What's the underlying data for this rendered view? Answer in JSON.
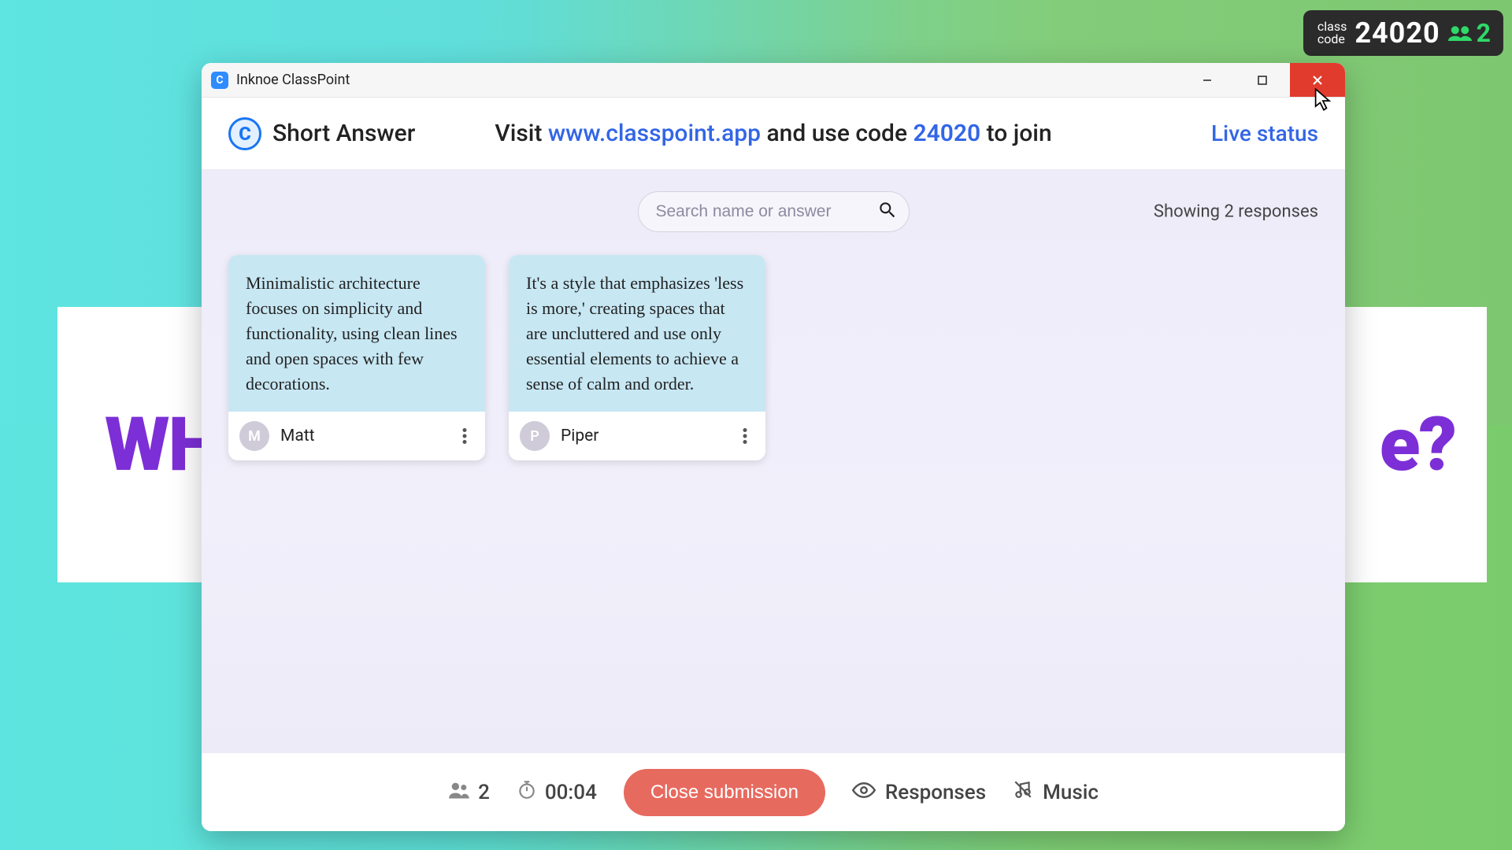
{
  "classBadge": {
    "label_line1": "class",
    "label_line2": "code",
    "code": "24020",
    "participants": "2"
  },
  "slide": {
    "left_fragment": "WH",
    "right_fragment": "e?"
  },
  "window": {
    "title": "Inknoe ClassPoint"
  },
  "header": {
    "activity_title": "Short Answer",
    "visit_prefix": "Visit ",
    "url": "www.classpoint.app",
    "use_code_mid": " and use code ",
    "code": "24020",
    "to_join": " to join",
    "live_status": "Live status"
  },
  "search": {
    "placeholder": "Search name or answer"
  },
  "showing": {
    "prefix": "Showing ",
    "count": "2",
    "suffix": " responses"
  },
  "responses": [
    {
      "text": "Minimalistic architecture focuses on simplicity and functionality, using clean lines and open spaces with few decorations.",
      "initial": "M",
      "name": "Matt"
    },
    {
      "text": "It's a style that emphasizes 'less is more,' creating spaces that are uncluttered and use only essential elements to achieve a sense of calm and order.",
      "initial": "P",
      "name": "Piper"
    }
  ],
  "bottom": {
    "participants": "2",
    "timer": "00:04",
    "close_label": "Close submission",
    "responses_label": "Responses",
    "music_label": "Music"
  }
}
